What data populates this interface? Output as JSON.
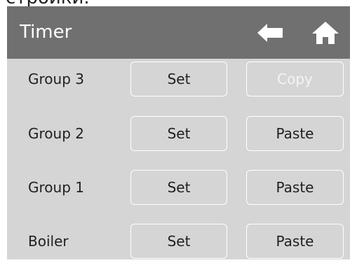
{
  "top_strip_text": "стройки.",
  "header": {
    "title": "Timer"
  },
  "rows": [
    {
      "label": "Group 3",
      "set_label": "Set",
      "alt_label": "Copy",
      "alt_enabled": false
    },
    {
      "label": "Group 2",
      "set_label": "Set",
      "alt_label": "Paste",
      "alt_enabled": true
    },
    {
      "label": "Group 1",
      "set_label": "Set",
      "alt_label": "Paste",
      "alt_enabled": true
    },
    {
      "label": "Boiler",
      "set_label": "Set",
      "alt_label": "Paste",
      "alt_enabled": true
    }
  ],
  "colors": {
    "header_bg": "#707070",
    "panel_bg": "#d5d5d5",
    "button_border": "#ffffff",
    "disabled_text": "#f4f4f4"
  },
  "icons": {
    "back": "back-arrow-icon",
    "home": "home-icon"
  }
}
